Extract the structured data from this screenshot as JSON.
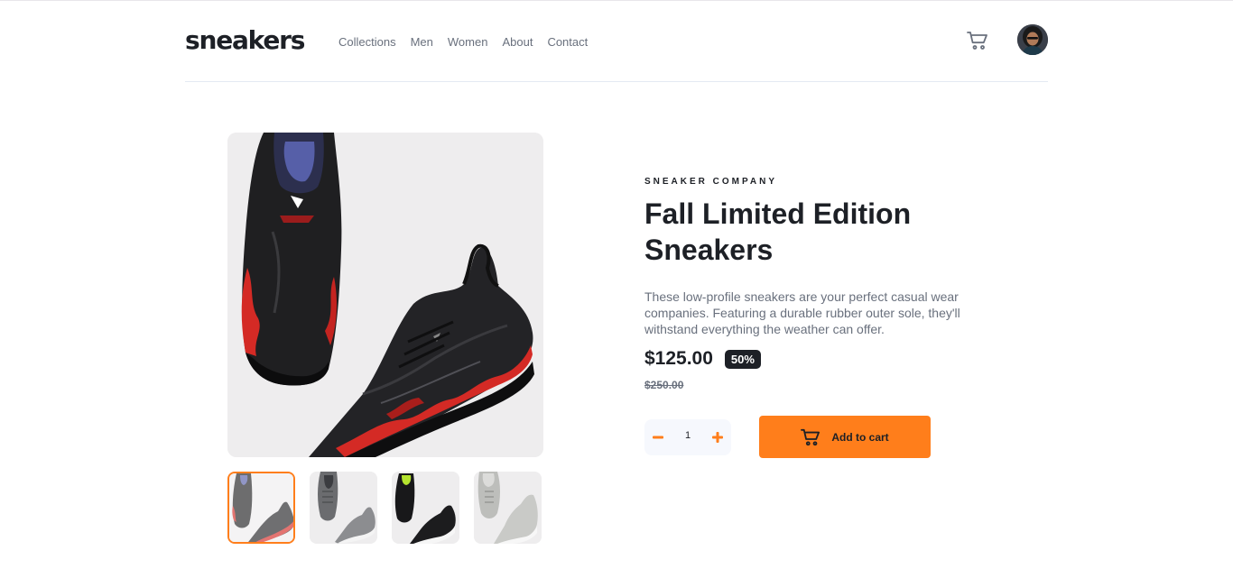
{
  "brand": {
    "logo": "sneakers"
  },
  "nav": {
    "items": [
      {
        "label": "Collections"
      },
      {
        "label": "Men"
      },
      {
        "label": "Women"
      },
      {
        "label": "About"
      },
      {
        "label": "Contact"
      }
    ]
  },
  "header": {
    "cart_icon": "cart-icon",
    "avatar": "user-avatar"
  },
  "gallery": {
    "main_image": "black-red-sneakers",
    "thumbnails": [
      {
        "name": "black-red-sneakers",
        "active": true
      },
      {
        "name": "grey-sneakers",
        "active": false
      },
      {
        "name": "black-green-sneakers",
        "active": false
      },
      {
        "name": "white-high-top-sneakers",
        "active": false
      }
    ]
  },
  "product": {
    "company": "SNEAKER COMPANY",
    "title": "Fall Limited Edition Sneakers",
    "description": "These low-profile sneakers are your perfect casual wear companies. Featuring a durable rubber outer sole, they'll withstand everything the weather can offer.",
    "price": "$125.00",
    "discount": "50%",
    "original_price": "$250.00"
  },
  "cart_controls": {
    "quantity": "1",
    "add_to_cart_label": "Add to cart"
  },
  "colors": {
    "accent": "#ff7e1b",
    "text_dark": "#1d2026",
    "text_muted": "#69707d",
    "light_bg": "#f6f8fd"
  }
}
